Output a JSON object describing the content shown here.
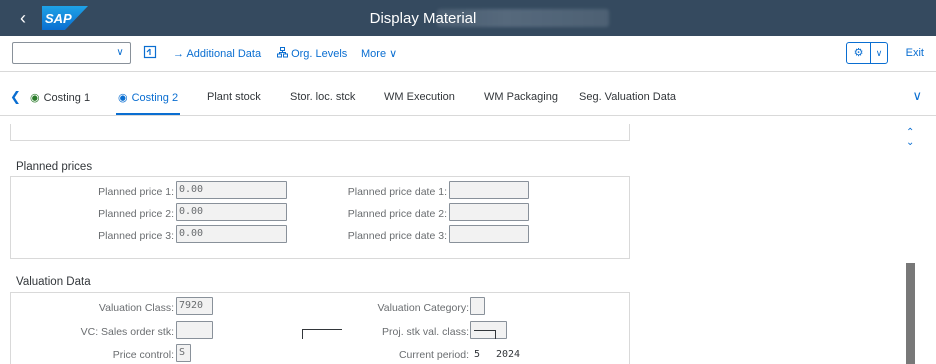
{
  "shell": {
    "title": "Display Material",
    "logo_text": "SAP",
    "back_icon": "chevron-left-icon"
  },
  "toolbar": {
    "combo_value": "",
    "buttons": [
      "Additional Data",
      "Org. Levels",
      "More"
    ],
    "exit_label": "Exit"
  },
  "tabs": [
    "Costing 1",
    "Costing 2",
    "Plant stock",
    "Stor. loc. stck",
    "WM Execution",
    "WM Packaging",
    "Seg. Valuation Data"
  ],
  "active_tab": "Costing 2",
  "planned_prices": {
    "title": "Planned prices",
    "rows": [
      {
        "label": "Planned price 1:",
        "value": "0.00",
        "date_label": "Planned price date 1:",
        "date_value": ""
      },
      {
        "label": "Planned price 2:",
        "value": "0.00",
        "date_label": "Planned price date 2:",
        "date_value": ""
      },
      {
        "label": "Planned price 3:",
        "value": "0.00",
        "date_label": "Planned price date 3:",
        "date_value": ""
      }
    ]
  },
  "valuation": {
    "title": "Valuation Data",
    "valuation_class_label": "Valuation Class:",
    "valuation_class_value": "7920",
    "valuation_category_label": "Valuation Category:",
    "valuation_category_value": "",
    "vc_sales_label": "VC: Sales order stk:",
    "vc_sales_value": "",
    "proj_stk_label": "Proj. stk val. class:",
    "proj_stk_value": "",
    "price_control_label": "Price control:",
    "price_control_value": "S",
    "current_period_label": "Current period:",
    "current_period_month": "5",
    "current_period_year": "2024"
  }
}
